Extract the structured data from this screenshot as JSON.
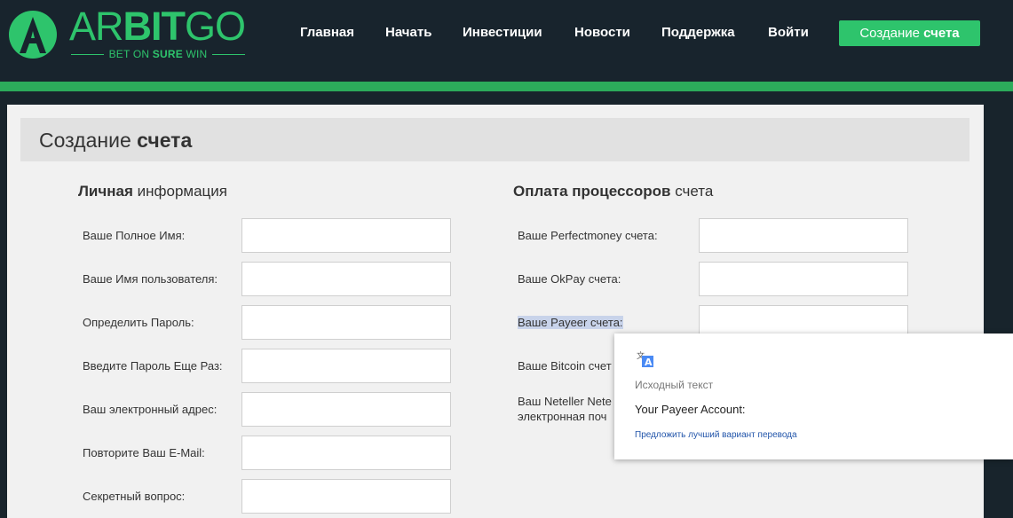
{
  "logo": {
    "ar": "AR",
    "bit": "BIT",
    "go": "GO",
    "tagline_pre": "BET ON ",
    "tagline_bold": "SURE",
    "tagline_post": " WIN"
  },
  "nav": {
    "items": [
      "Главная",
      "Начать",
      "Инвестиции",
      "Новости",
      "Поддержка",
      "Войти"
    ],
    "create_pre": "Создание ",
    "create_bold": "счета"
  },
  "page": {
    "title_pre": "Создание ",
    "title_bold": "счета"
  },
  "personal": {
    "heading_bold": "Личная",
    "heading_rest": " информация",
    "labels": [
      "Ваше Полное Имя:",
      "Ваше Имя пользователя:",
      "Определить Пароль:",
      "Введите Пароль Еще Раз:",
      "Ваш электронный адрес:",
      "Повторите Ваш E-Mail:",
      "Секретный вопрос:"
    ]
  },
  "payment": {
    "heading_bold": "Оплата процессоров",
    "heading_rest": " счета",
    "labels": [
      "Ваше Perfectmoney счета:",
      "Ваше OkPay счета:",
      "Ваше Payeer счета:",
      "Ваше Bitcoin счет",
      "Ваш Neteller Nete",
      "электронная поч"
    ]
  },
  "translate_popup": {
    "source_label": "Исходный текст",
    "source_text": "Your Payeer Account:",
    "suggest_link": "Предложить лучший вариант перевода"
  },
  "colors": {
    "brand_green": "#2ec46c",
    "header_bg": "#18242d",
    "accent_bar": "#2cab5b"
  }
}
